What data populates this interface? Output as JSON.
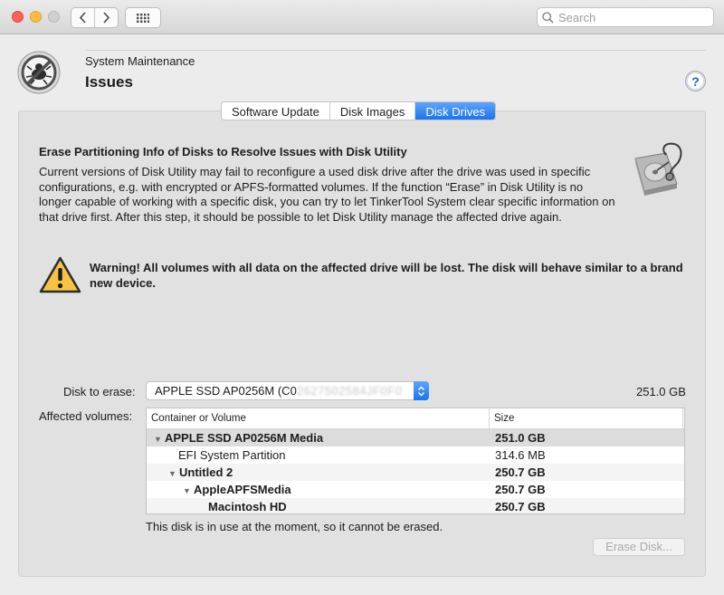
{
  "toolbar": {
    "search_placeholder": "Search"
  },
  "header": {
    "section": "System Maintenance",
    "title": "Issues",
    "help": "?"
  },
  "tabs": [
    {
      "label": "Software Update",
      "active": false
    },
    {
      "label": "Disk Images",
      "active": false
    },
    {
      "label": "Disk Drives",
      "active": true
    }
  ],
  "content": {
    "title": "Erase Partitioning Info of Disks to Resolve Issues with Disk Utility",
    "description": "Current versions of Disk Utility may fail to reconfigure a used disk drive after the drive was used in specific configurations, e.g. with encrypted or APFS-formatted volumes. If the function “Erase” in Disk Utility is no longer capable of working with a specific disk, you can try to let TinkerTool System clear specific information on that drive first. After this step, it should be possible to let Disk Utility manage the affected drive again.",
    "warning": "Warning! All volumes with all data on the affected drive will be lost. The disk will behave similar to a brand new device."
  },
  "disk": {
    "label": "Disk to erase:",
    "selected": "APPLE SSD AP0256M (C0",
    "selected_obscured": "2627502584JF0F0",
    "size": "251.0 GB"
  },
  "volumes": {
    "label": "Affected volumes:",
    "columns": [
      "Container or Volume",
      "Size"
    ],
    "rows": [
      {
        "name": "APPLE SSD AP0256M Media",
        "size": "251.0 GB",
        "level": 0,
        "disclosure": true,
        "bold": true
      },
      {
        "name": "EFI System Partition",
        "size": "314.6 MB",
        "level": 1,
        "disclosure": false,
        "bold": false
      },
      {
        "name": "Untitled 2",
        "size": "250.7 GB",
        "level": 1,
        "disclosure": true,
        "bold": true
      },
      {
        "name": "AppleAPFSMedia",
        "size": "250.7 GB",
        "level": 2,
        "disclosure": true,
        "bold": true
      },
      {
        "name": "Macintosh HD",
        "size": "250.7 GB",
        "level": 3,
        "disclosure": false,
        "bold": true
      }
    ]
  },
  "status": "This disk is in use at the moment, so it cannot be erased.",
  "erase_button": "Erase Disk..."
}
